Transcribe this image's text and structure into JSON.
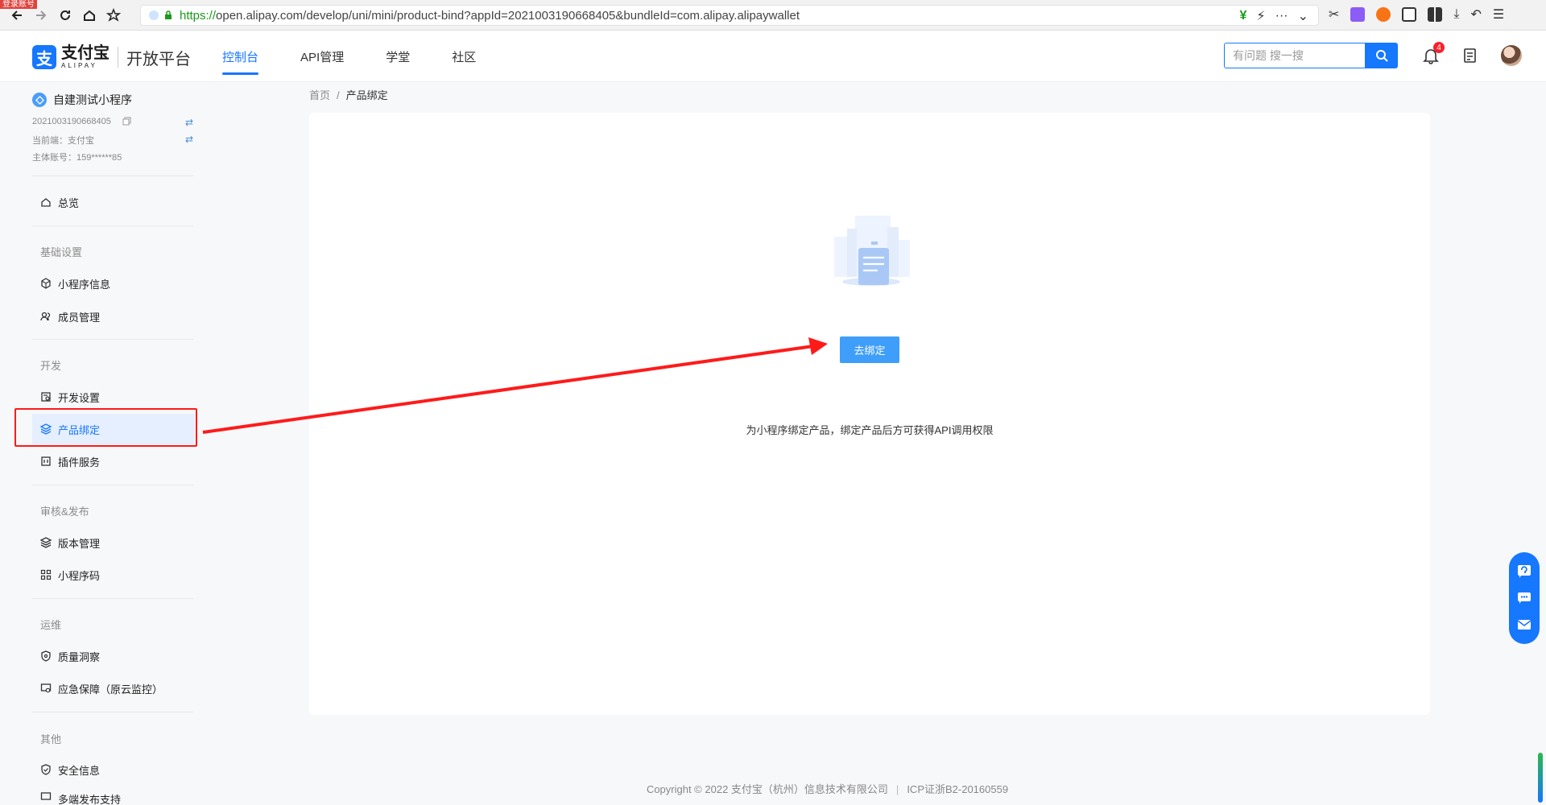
{
  "browser": {
    "login_badge": "登录账号",
    "url_scheme": "https://",
    "url_rest": "open.alipay.com/develop/uni/mini/product-bind?appId=2021003190668405&bundleId=com.alipay.alipaywallet",
    "more": "···"
  },
  "header": {
    "logo_cn": "支付宝",
    "logo_en": "ALIPAY",
    "platform": "开放平台",
    "nav": [
      "控制台",
      "API管理",
      "学堂",
      "社区"
    ],
    "search_placeholder": "有问题 搜一搜",
    "notification_count": "4"
  },
  "sidebar": {
    "app_name": "自建测试小程序",
    "app_id": "2021003190668405",
    "current_end": "当前端：支付宝",
    "account": "主体账号：159******85",
    "overview": "总览",
    "groups": {
      "basic": "基础设置",
      "dev": "开发",
      "review": "审核&发布",
      "ops": "运维",
      "other": "其他"
    },
    "items": {
      "app_info": "小程序信息",
      "members": "成员管理",
      "dev_settings": "开发设置",
      "product_bind": "产品绑定",
      "plugin": "插件服务",
      "version": "版本管理",
      "qrcode": "小程序码",
      "quality": "质量洞察",
      "emergency": "应急保障（原云监控）",
      "security": "安全信息",
      "multi_end": "多端发布支持"
    }
  },
  "content": {
    "breadcrumb_home": "首页",
    "breadcrumb_sep": "/",
    "breadcrumb_current": "产品绑定",
    "empty_text": "为小程序绑定产品，绑定产品后方可获得API调用权限",
    "bind_button": "去绑定"
  },
  "footer": {
    "copyright": "Copyright © 2022 支付宝（杭州）信息技术有限公司",
    "sep": "|",
    "icp": "ICP证浙B2-20160559"
  },
  "colors": {
    "brand": "#1677ff",
    "button": "#3e9ef9",
    "annotation": "#ff1a1a"
  }
}
